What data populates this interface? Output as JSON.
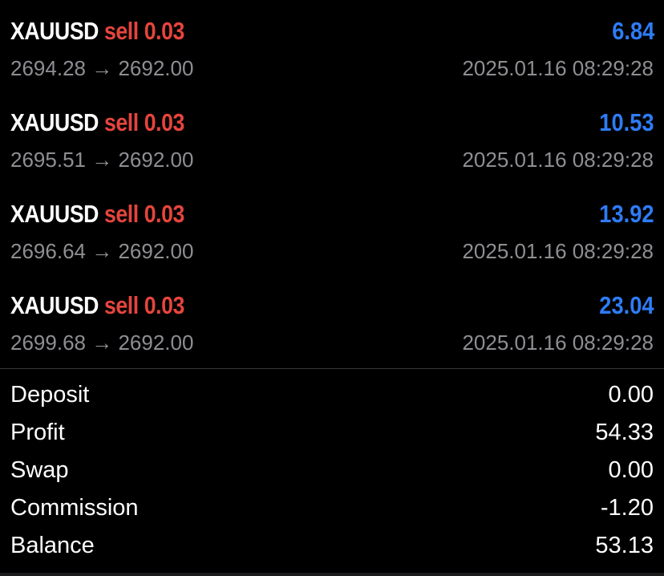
{
  "colors": {
    "background": "#000000",
    "sell": "#e5453d",
    "profit_positive": "#2e7cf6",
    "secondary_text": "#8e8e93",
    "primary_text": "#ffffff"
  },
  "trades": [
    {
      "symbol": "XAUUSD",
      "side": "sell",
      "lots": "0.03",
      "profit": "6.84",
      "open_price": "2694.28",
      "arrow": "→",
      "close_price": "2692.00",
      "time": "2025.01.16 08:29:28"
    },
    {
      "symbol": "XAUUSD",
      "side": "sell",
      "lots": "0.03",
      "profit": "10.53",
      "open_price": "2695.51",
      "arrow": "→",
      "close_price": "2692.00",
      "time": "2025.01.16 08:29:28"
    },
    {
      "symbol": "XAUUSD",
      "side": "sell",
      "lots": "0.03",
      "profit": "13.92",
      "open_price": "2696.64",
      "arrow": "→",
      "close_price": "2692.00",
      "time": "2025.01.16 08:29:28"
    },
    {
      "symbol": "XAUUSD",
      "side": "sell",
      "lots": "0.03",
      "profit": "23.04",
      "open_price": "2699.68",
      "arrow": "→",
      "close_price": "2692.00",
      "time": "2025.01.16 08:29:28"
    }
  ],
  "summary": [
    {
      "label": "Deposit",
      "value": "0.00"
    },
    {
      "label": "Profit",
      "value": "54.33"
    },
    {
      "label": "Swap",
      "value": "0.00"
    },
    {
      "label": "Commission",
      "value": "-1.20"
    },
    {
      "label": "Balance",
      "value": "53.13"
    }
  ]
}
